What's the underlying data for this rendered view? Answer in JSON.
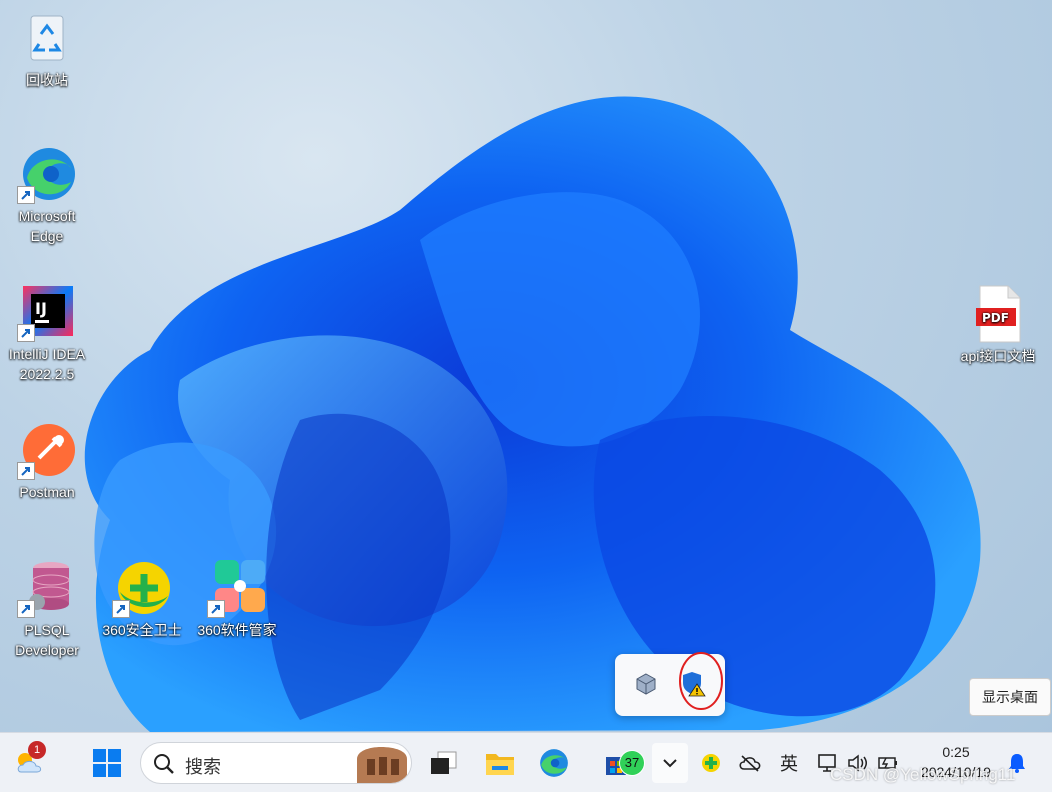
{
  "desktop": {
    "icons": [
      {
        "label": "回收站"
      },
      {
        "label": "Microsoft Edge"
      },
      {
        "label": "IntelliJ IDEA 2022.2.5"
      },
      {
        "label": "Postman"
      },
      {
        "label": "PLSQL Developer"
      },
      {
        "label": "360安全卫士"
      },
      {
        "label": "360软件管家"
      },
      {
        "label": "api接口文档"
      }
    ],
    "pdf_badge": "PDF",
    "ij_badge": "IJ"
  },
  "tray_popup": {
    "icons": [
      "virtualbox-icon",
      "windows-security-warning-icon"
    ]
  },
  "show_desktop_tooltip": "显示桌面",
  "taskbar": {
    "weather_badge": "1",
    "search_placeholder": "搜索",
    "app_badge": "37",
    "ime_label": "英",
    "time": "0:25",
    "date": "2024/10/19"
  },
  "watermark": "CSDN @YellowSpring11",
  "colors": {
    "accent": "#0a5cff",
    "taskbar_bg": "#eef1f6"
  }
}
